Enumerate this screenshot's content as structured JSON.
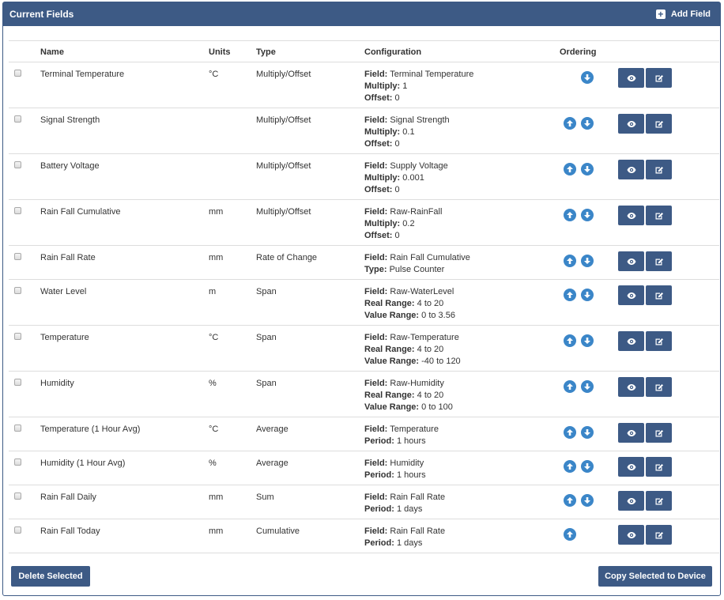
{
  "panel": {
    "title": "Current Fields",
    "add_label": "Add Field"
  },
  "columns": {
    "name": "Name",
    "units": "Units",
    "type": "Type",
    "config": "Configuration",
    "ordering": "Ordering"
  },
  "rows": [
    {
      "name": "Terminal Temperature",
      "units": "°C",
      "type": "Multiply/Offset",
      "up": false,
      "down": true,
      "config": [
        [
          "Field:",
          "Terminal Temperature"
        ],
        [
          "Multiply:",
          "1"
        ],
        [
          "Offset:",
          "0"
        ]
      ]
    },
    {
      "name": "Signal Strength",
      "units": "",
      "type": "Multiply/Offset",
      "up": true,
      "down": true,
      "config": [
        [
          "Field:",
          "Signal Strength"
        ],
        [
          "Multiply:",
          "0.1"
        ],
        [
          "Offset:",
          "0"
        ]
      ]
    },
    {
      "name": "Battery Voltage",
      "units": "",
      "type": "Multiply/Offset",
      "up": true,
      "down": true,
      "config": [
        [
          "Field:",
          "Supply Voltage"
        ],
        [
          "Multiply:",
          "0.001"
        ],
        [
          "Offset:",
          "0"
        ]
      ]
    },
    {
      "name": "Rain Fall Cumulative",
      "units": "mm",
      "type": "Multiply/Offset",
      "up": true,
      "down": true,
      "config": [
        [
          "Field:",
          "Raw-RainFall"
        ],
        [
          "Multiply:",
          "0.2"
        ],
        [
          "Offset:",
          "0"
        ]
      ]
    },
    {
      "name": "Rain Fall Rate",
      "units": "mm",
      "type": "Rate of Change",
      "up": true,
      "down": true,
      "config": [
        [
          "Field:",
          "Rain Fall Cumulative"
        ],
        [
          "Type:",
          "Pulse Counter"
        ]
      ]
    },
    {
      "name": "Water Level",
      "units": "m",
      "type": "Span",
      "up": true,
      "down": true,
      "config": [
        [
          "Field:",
          "Raw-WaterLevel"
        ],
        [
          "Real Range:",
          "4 to 20"
        ],
        [
          "Value Range:",
          "0 to 3.56"
        ]
      ]
    },
    {
      "name": "Temperature",
      "units": "°C",
      "type": "Span",
      "up": true,
      "down": true,
      "config": [
        [
          "Field:",
          "Raw-Temperature"
        ],
        [
          "Real Range:",
          "4 to 20"
        ],
        [
          "Value Range:",
          "-40 to 120"
        ]
      ]
    },
    {
      "name": "Humidity",
      "units": "%",
      "type": "Span",
      "up": true,
      "down": true,
      "config": [
        [
          "Field:",
          "Raw-Humidity"
        ],
        [
          "Real Range:",
          "4 to 20"
        ],
        [
          "Value Range:",
          "0 to 100"
        ]
      ]
    },
    {
      "name": "Temperature (1 Hour Avg)",
      "units": "°C",
      "type": "Average",
      "up": true,
      "down": true,
      "config": [
        [
          "Field:",
          "Temperature"
        ],
        [
          "Period:",
          "1 hours"
        ]
      ]
    },
    {
      "name": "Humidity (1 Hour Avg)",
      "units": "%",
      "type": "Average",
      "up": true,
      "down": true,
      "config": [
        [
          "Field:",
          "Humidity"
        ],
        [
          "Period:",
          "1 hours"
        ]
      ]
    },
    {
      "name": "Rain Fall Daily",
      "units": "mm",
      "type": "Sum",
      "up": true,
      "down": true,
      "config": [
        [
          "Field:",
          "Rain Fall Rate"
        ],
        [
          "Period:",
          "1 days"
        ]
      ]
    },
    {
      "name": "Rain Fall Today",
      "units": "mm",
      "type": "Cumulative",
      "up": true,
      "down": false,
      "config": [
        [
          "Field:",
          "Rain Fall Rate"
        ],
        [
          "Period:",
          "1 days"
        ]
      ]
    }
  ],
  "footer": {
    "delete_label": "Delete Selected",
    "copy_label": "Copy Selected to Device"
  },
  "colors": {
    "header": "#3d5a85",
    "arrow": "#3b86c8",
    "border": "#dddddd"
  }
}
